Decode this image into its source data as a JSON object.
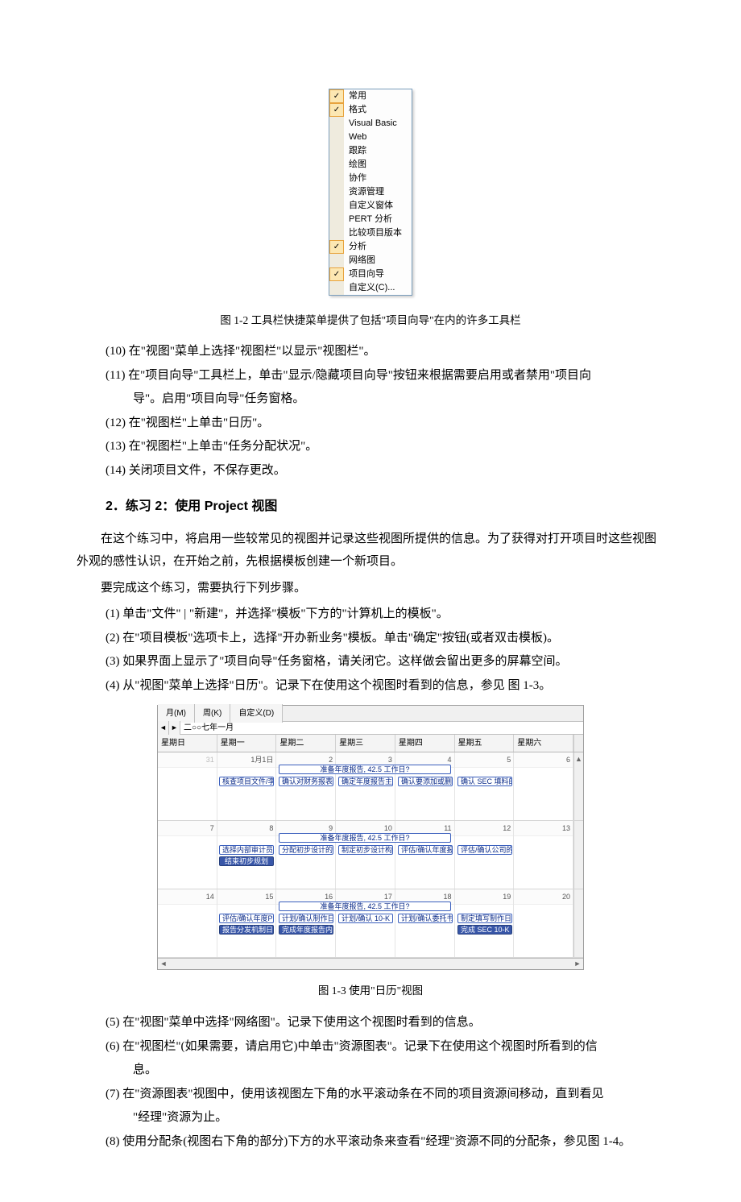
{
  "figure1_2": {
    "menu_items": [
      {
        "label": "常用",
        "checked": true
      },
      {
        "label": "格式",
        "checked": true
      },
      {
        "label": "Visual Basic",
        "checked": false
      },
      {
        "label": "Web",
        "checked": false
      },
      {
        "label": "跟踪",
        "checked": false
      },
      {
        "label": "绘图",
        "checked": false
      },
      {
        "label": "协作",
        "checked": false
      },
      {
        "label": "资源管理",
        "checked": false
      },
      {
        "label": "自定义窗体",
        "checked": false
      },
      {
        "label": "PERT 分析",
        "checked": false
      },
      {
        "label": "比较项目版本",
        "checked": false
      },
      {
        "label": "分析",
        "checked": true
      },
      {
        "label": "网络图",
        "checked": false
      },
      {
        "label": "项目向导",
        "checked": true
      },
      {
        "label": "自定义(C)...",
        "checked": false
      }
    ],
    "caption": "图 1-2   工具栏快捷菜单提供了包括\"项目向导\"在内的许多工具栏"
  },
  "steps_a": {
    "s10": "(10) 在\"视图\"菜单上选择\"视图栏\"以显示\"视图栏\"。",
    "s11": "(11) 在\"项目向导\"工具栏上，单击\"显示/隐藏项目向导\"按钮来根据需要启用或者禁用\"项目向",
    "s11b": "导\"。启用\"项目向导\"任务窗格。",
    "s12": "(12) 在\"视图栏\"上单击\"日历\"。",
    "s13": "(13) 在\"视图栏\"上单击\"任务分配状况\"。",
    "s14": "(14) 关闭项目文件，不保存更改。"
  },
  "section2": {
    "heading": "2．练习 2：使用 Project 视图",
    "p1": "在这个练习中，将启用一些较常见的视图并记录这些视图所提供的信息。为了获得对打开项目时这些视图外观的感性认识，在开始之前，先根据模板创建一个新项目。",
    "p2": "要完成这个练习，需要执行下列步骤。",
    "s1": "(1)   单击\"文件\" | \"新建\"，并选择\"模板\"下方的\"计算机上的模板\"。",
    "s2": "(2)   在\"项目模板\"选项卡上，选择\"开办新业务\"模板。单击\"确定\"按钮(或者双击模板)。",
    "s3": "(3)   如果界面上显示了\"项目向导\"任务窗格，请关闭它。这样做会留出更多的屏幕空间。",
    "s4": "(4)   从\"视图\"菜单上选择\"日历\"。记录下在使用这个视图时看到的信息，参见 图 1-3。"
  },
  "figure1_3": {
    "tabs": {
      "month": "月(M)",
      "week": "周(K)",
      "custom": "自定义(D)"
    },
    "nav_month": "二○○七年一月",
    "days": [
      "星期日",
      "星期一",
      "星期二",
      "星期三",
      "星期四",
      "星期五",
      "星期六"
    ],
    "week1_nums": [
      "31",
      "1月1日",
      "2",
      "3",
      "4",
      "5",
      "6"
    ],
    "week2_nums": [
      "7",
      "8",
      "9",
      "10",
      "11",
      "12",
      "13"
    ],
    "week3_nums": [
      "14",
      "15",
      "16",
      "17",
      "18",
      "19",
      "20"
    ],
    "span1": "准备年度报告, 42.5 工作日?",
    "w1_tasks": [
      "核查项目文件/李",
      "确认对财务报表",
      "确定年度报告主",
      "确认要添加或删",
      "确认 SEC 填料的"
    ],
    "span2": "准备年度报告, 42.5 工作日?",
    "w2_tasks": [
      "选择内部审计员",
      "分配初步设计的",
      "制定初步设计构",
      "评估/确认年度报",
      "评估/确认公司的"
    ],
    "w2_dark": "结束初步规划",
    "span3": "准备年度报告, 42.5 工作日?",
    "w3_tasks_r1": [
      "评估/确认年度P",
      "计划/确认制作日",
      "计划/确认 10-K",
      "计划/确认委托书",
      "制定填写制作日"
    ],
    "w3_tasks_r2": [
      "报告分发机制日",
      "完成年度报告内",
      "",
      "",
      "完成 SEC 10-K"
    ],
    "caption": "图 1-3   使用\"日历\"视图"
  },
  "steps_b": {
    "s5": "(5)   在\"视图\"菜单中选择\"网络图\"。记录下使用这个视图时看到的信息。",
    "s6": "(6)   在\"视图栏\"(如果需要，请启用它)中单击\"资源图表\"。记录下在使用这个视图时所看到的信",
    "s6b": "息。",
    "s7": "(7)   在\"资源图表\"视图中，使用该视图左下角的水平滚动条在不同的项目资源间移动，直到看见",
    "s7b": "\"经理\"资源为止。",
    "s8": "(8)   使用分配条(视图右下角的部分)下方的水平滚动条来查看\"经理\"资源不同的分配条，参见图 1-4。"
  }
}
